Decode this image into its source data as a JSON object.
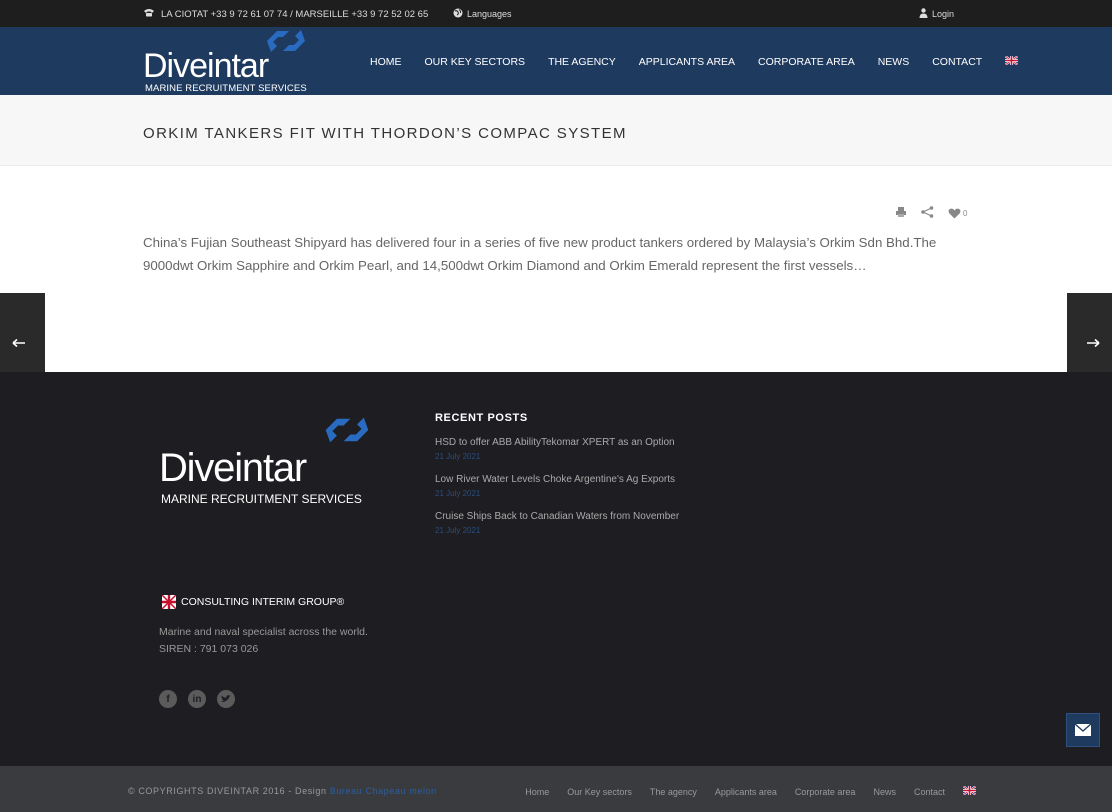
{
  "topbar": {
    "phone_text": "LA CIOTAT +33 9 72 61 07 74 / MARSEILLE +33 9 72 52 02 65",
    "languages_label": "Languages",
    "login_label": "Login"
  },
  "header": {
    "logo_word": "Diveintar",
    "logo_sub": "MARINE RECRUITMENT SERVICES",
    "nav": [
      "HOME",
      "OUR KEY SECTORS",
      "THE AGENCY",
      "APPLICANTS AREA",
      "CORPORATE AREA",
      "NEWS",
      "CONTACT"
    ]
  },
  "page": {
    "title": "ORKIM TANKERS FIT WITH THORDON’S COMPAC SYSTEM",
    "like_count": "0",
    "excerpt": "China’s Fujian Southeast Shipyard has delivered four in a series of five new product tankers ordered by Malaysia’s Orkim Sdn Bhd.The 9000dwt Orkim Sapphire and Orkim Pearl, and 14,500dwt Orkim Diamond and Orkim Emerald represent the first vessels…"
  },
  "footer": {
    "logo_word": "Diveintar",
    "logo_sub": "MARINE RECRUITMENT SERVICES",
    "consulting": "CONSULTING INTERIM GROUP®",
    "tagline": "Marine and naval specialist across the world.",
    "siren": "SIREN : 791 073 026",
    "recent_title": "RECENT POSTS",
    "posts": [
      {
        "title": "HSD to offer ABB AbilityTekomar XPERT as an Option",
        "date": "21 July 2021"
      },
      {
        "title": "Low River Water Levels Choke Argentine's Ag Exports",
        "date": "21 July 2021"
      },
      {
        "title": "Cruise Ships Back to Canadian Waters from November",
        "date": "21 July 2021"
      }
    ]
  },
  "bottombar": {
    "copyright": "© COPYRIGHTS DIVEINTAR 2016 - Design ",
    "design_link": "Bureau Chapeau melon",
    "nav": [
      "Home",
      "Our Key sectors",
      "The agency",
      "Applicants area",
      "Corporate area",
      "News",
      "Contact"
    ]
  },
  "colors": {
    "header_bg": "#1f3a5f",
    "footer_bg": "#1e1d21",
    "accent": "#2a5ea0"
  }
}
